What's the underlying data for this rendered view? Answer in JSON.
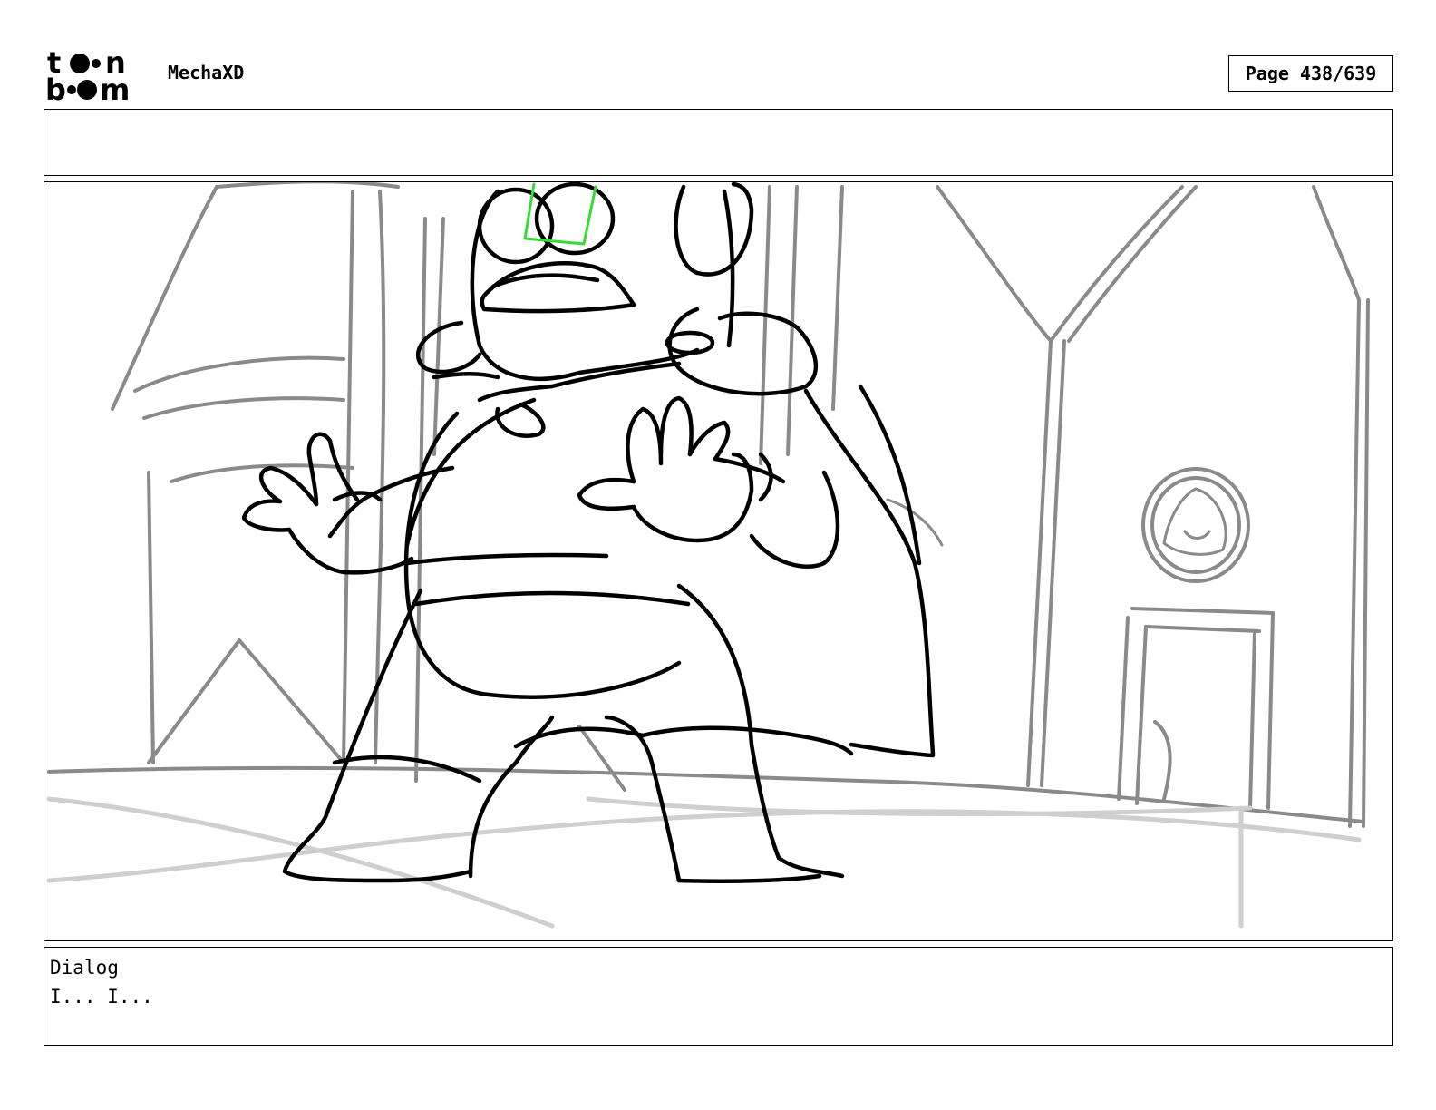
{
  "header": {
    "logo": {
      "text": "toon boom"
    },
    "project_title": "MechaXD",
    "page_label": "Page 438/639"
  },
  "notes": {
    "text": ""
  },
  "panel": {
    "description": "storyboard-drawing",
    "highlight_color": "#33dd33"
  },
  "dialog": {
    "label": "Dialog",
    "text": "I... I..."
  }
}
